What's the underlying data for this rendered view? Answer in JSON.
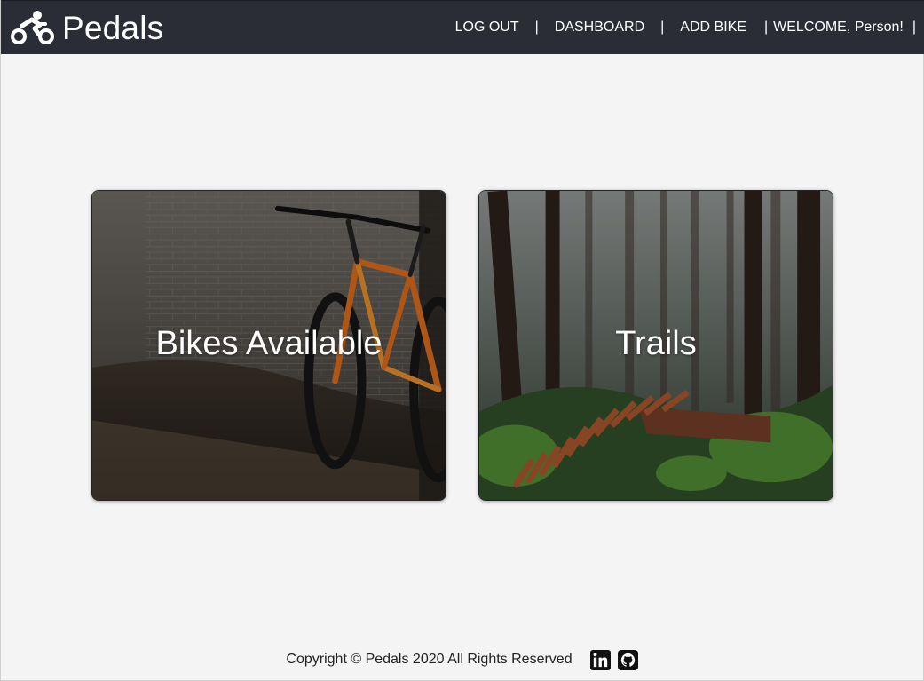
{
  "header": {
    "brand": "Pedals",
    "nav": {
      "logout": "LOG OUT",
      "dashboard": "DASHBOARD",
      "add_bike": "ADD BIKE",
      "separator": "|",
      "welcome": "WELCOME, Person!"
    }
  },
  "cards": [
    {
      "title": "Bikes Available",
      "image": "bike-photo"
    },
    {
      "title": "Trails",
      "image": "forest-trail-photo"
    }
  ],
  "footer": {
    "copyright": "Copyright © Pedals 2020 All Rights Reserved",
    "icons": [
      "linkedin-icon",
      "github-icon"
    ]
  },
  "colors": {
    "navbar": "#2a2d35",
    "page_background": "#f4f4f4",
    "text_dark": "#222222"
  }
}
